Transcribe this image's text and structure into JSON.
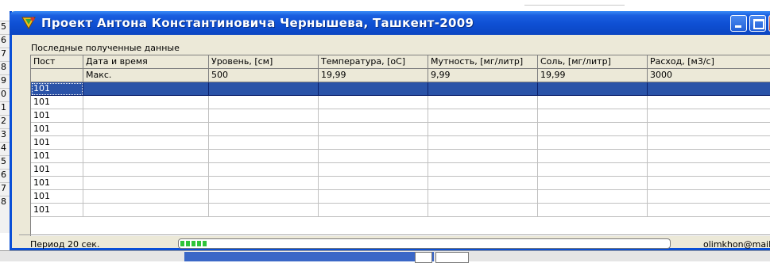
{
  "window": {
    "title": "Проект Антона Константиновича Чернышева, Ташкент-2009"
  },
  "row_gutter": [
    "5",
    "6",
    "7",
    "8",
    "9",
    "0",
    "1",
    "2",
    "3",
    "4",
    "5",
    "6",
    "7",
    "8"
  ],
  "section_label": "Последные полученные данные",
  "table": {
    "columns": [
      "Пост",
      "Дата и время",
      "Уровень, [см]",
      "Температура, [oC]",
      "Мутность, [мг/литр]",
      "Соль, [мг/литр]",
      "Расход, [м3/с]"
    ],
    "max_row": [
      "",
      "Макс.",
      "500",
      "19,99",
      "9,99",
      "19,99",
      "3000"
    ],
    "rows": [
      [
        "101",
        "",
        "",
        "",
        "",
        "",
        ""
      ],
      [
        "101",
        "",
        "",
        "",
        "",
        "",
        ""
      ],
      [
        "101",
        "",
        "",
        "",
        "",
        "",
        ""
      ],
      [
        "101",
        "",
        "",
        "",
        "",
        "",
        ""
      ],
      [
        "101",
        "",
        "",
        "",
        "",
        "",
        ""
      ],
      [
        "101",
        "",
        "",
        "",
        "",
        "",
        ""
      ],
      [
        "101",
        "",
        "",
        "",
        "",
        "",
        ""
      ],
      [
        "101",
        "",
        "",
        "",
        "",
        "",
        ""
      ],
      [
        "101",
        "",
        "",
        "",
        "",
        "",
        ""
      ],
      [
        "101",
        "",
        "",
        "",
        "",
        "",
        ""
      ]
    ],
    "selected_row_index": 0
  },
  "status": {
    "period": "Период 20 сек.",
    "progress_fraction": 0.06,
    "email": "olimkhon@mail.ru"
  },
  "colors": {
    "titlebar": "#0e4fd3",
    "selection": "#2a53a8",
    "progress": "#2ec43a"
  }
}
